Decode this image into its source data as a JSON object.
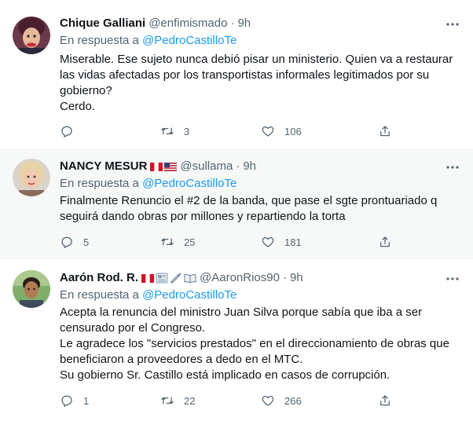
{
  "tweets": [
    {
      "name": "Chique Galliani",
      "handle": "@enfimismado",
      "sep": "·",
      "time": "9h",
      "reply_prefix": "En respuesta a",
      "reply_to": "@PedroCastilloTe",
      "lines": [
        "Miserable. Ese sujeto nunca debió pisar un ministerio. Quien va a restaurar",
        "las vidas afectadas por los transportistas informales legitimados por su",
        "gobierno?",
        "Cerdo."
      ],
      "replies": "",
      "retweets": "3",
      "likes": "106"
    },
    {
      "name": "NANCY MESUR",
      "handle": "@sullama",
      "sep": "·",
      "time": "9h",
      "reply_prefix": "En respuesta a",
      "reply_to": "@PedroCastilloTe",
      "lines": [
        "Finalmente Renuncio el #2  de la banda, que pase el sgte prontuariado q",
        "seguirá dando obras por millones y repartiendo la torta"
      ],
      "replies": "5",
      "retweets": "25",
      "likes": "181"
    },
    {
      "name": "Aarón Rod. R.",
      "handle": "@AaronRios90",
      "sep": "·",
      "time": "9h",
      "reply_prefix": "En respuesta a",
      "reply_to": "@PedroCastilloTe",
      "lines": [
        "Acepta la renuncia del ministro Juan Silva porque sabía que iba a ser",
        "censurado por el Congreso.",
        "Le agradece los \"servicios prestados\" en el direccionamiento de obras que",
        "beneficiaron a proveedores a dedo en el MTC.",
        "Su gobierno Sr. Castillo está implicado en casos de corrupción."
      ],
      "replies": "1",
      "retweets": "22",
      "likes": "266"
    }
  ],
  "icons": {
    "reply": "reply-icon",
    "retweet": "retweet-icon",
    "like": "like-icon",
    "share": "share-icon",
    "more": "more-icon"
  },
  "colors": {
    "text": "#0f1419",
    "secondary": "#536471",
    "link": "#1d9bf0",
    "border": "#eff3f4",
    "hover_bg": "#f7f9f9"
  }
}
